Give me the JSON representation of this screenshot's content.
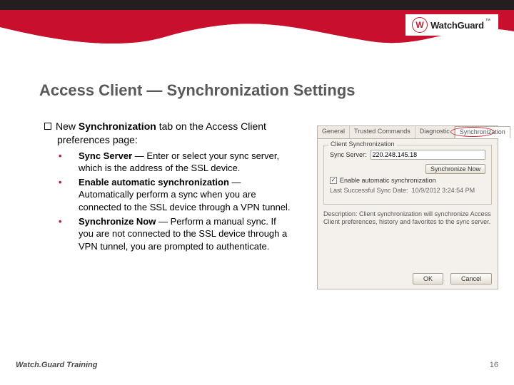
{
  "logo": {
    "brand": "Watch",
    "brand2": "Guard",
    "tm": "™",
    "mark": "W"
  },
  "title": "Access Client — Synchronization Settings",
  "lead": {
    "text_a": "New ",
    "bold": "Synchronization",
    "text_b": " tab on the Access Client  preferences page:"
  },
  "bullets": [
    {
      "bold": "Sync Server",
      "text": " — Enter or select your sync server, which is the address of the SSL device."
    },
    {
      "bold": "Enable automatic synchronization",
      "text": " — Automatically perform a sync when you are connected to the SSL device through a VPN tunnel."
    },
    {
      "bold": "Synchronize Now",
      "text": " — Perform a manual sync. If you are not connected to the SSL device through a VPN tunnel, you are prompted to authenticate."
    }
  ],
  "panel": {
    "tabs": [
      "General",
      "Trusted Commands",
      "Diagnostic",
      "Synchronization"
    ],
    "legend": "Client Synchronization",
    "sync_server_label": "Sync Server:",
    "sync_server_value": "220.248.145.18",
    "sync_now": "Synchronize Now",
    "enable_auto": "Enable automatic synchronization",
    "last_sync_label": "Last Successful Sync Date:",
    "last_sync_value": "10/9/2012 3:24:54 PM",
    "description": "Description: Client synchronization will synchronize Access Client preferences, history and favorites to the sync server.",
    "ok": "OK",
    "cancel": "Cancel"
  },
  "footer": {
    "left_a": "Watch.",
    "left_b": "Guard Training",
    "page": "16"
  }
}
